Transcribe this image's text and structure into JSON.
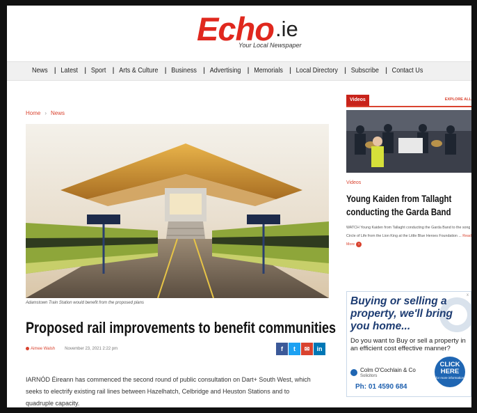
{
  "site": {
    "logo_main": "Echo",
    "logo_suffix": ".ie",
    "tagline": "Your Local Newspaper"
  },
  "nav": {
    "items": [
      "News",
      "Latest",
      "Sport",
      "Arts & Culture",
      "Business",
      "Advertising",
      "Memorials",
      "Local Directory",
      "Subscribe",
      "Contact Us"
    ]
  },
  "breadcrumb": {
    "home": "Home",
    "section": "News"
  },
  "article": {
    "image_caption": "Adamstown Train Station would benefit from the proposed plans",
    "headline": "Proposed rail improvements to benefit communities",
    "author": "Aimee Walsh",
    "date": "November 23, 2021 2:22 pm",
    "lead": "IARNÓD Éireann has commenced the second round of public consultation on Dart+ South West, which seeks to electrify existing rail lines between Hazelhatch, Celbridge and Heuston Stations and to quadruple capacity."
  },
  "share": {
    "facebook": "f",
    "twitter": "t",
    "email": "✉",
    "linkedin": "in"
  },
  "sidebar": {
    "section_label": "Videos",
    "explore_label": "EXPLORE ALL",
    "video": {
      "category": "Videos",
      "title": "Young Kaiden from Tallaght conducting the Garda Band",
      "snippet": "WATCH Young Kaiden from Tallaght conducting the Garda Band to the song Circle of Life from the Lion King at the Little Blue Heroes Foundation ...",
      "read_more": "Read More"
    }
  },
  "ad": {
    "headline": "Buying or selling a property, we'll bring you home...",
    "subtext": "Do you want to Buy or sell a property in an efficient cost effective manner?",
    "firm": "Colm O'Cochlain & Co",
    "firm_sub": "Solicitors",
    "phone": "Ph: 01 4590 684",
    "cta_big": "CLICK HERE",
    "cta_small": "for more information",
    "close": "x"
  },
  "colors": {
    "brand_red": "#e0281e",
    "accent": "#d9432f",
    "ad_blue": "#1d3c72",
    "train_green": "#8ea63a"
  },
  "icons": {
    "author": "person-dot-icon",
    "read_more": "arrow-circle-icon",
    "firm": "firm-logo-icon"
  }
}
